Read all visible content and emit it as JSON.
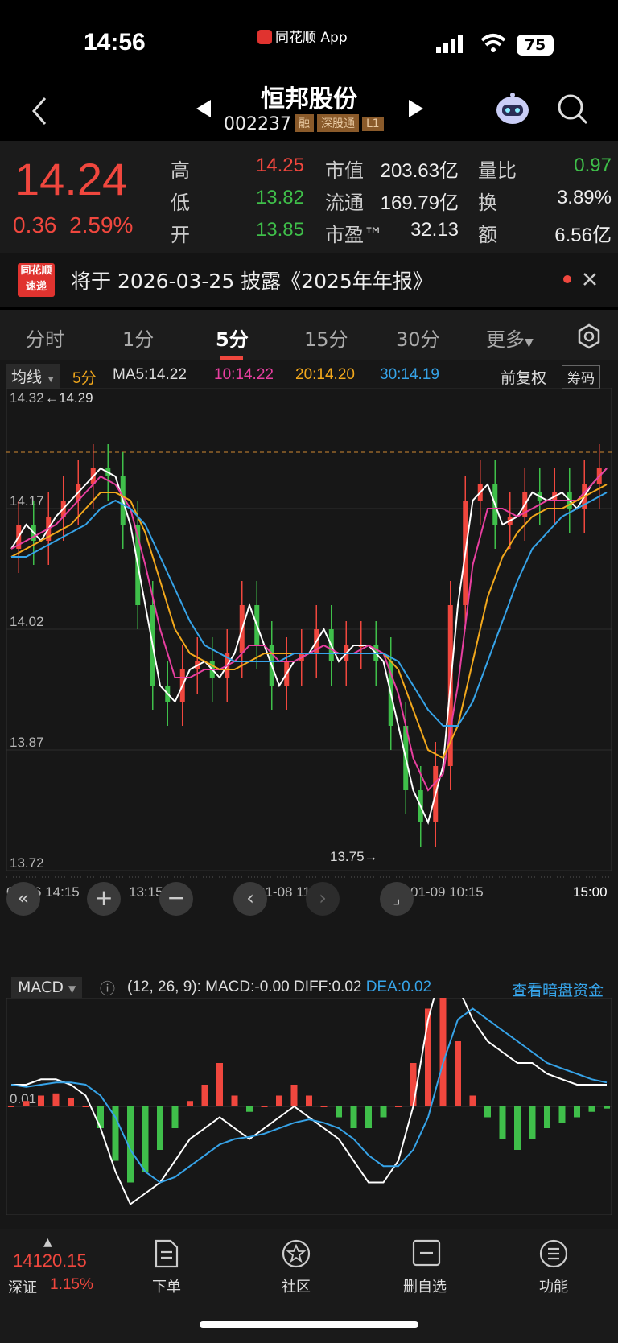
{
  "status_bar": {
    "time": "14:56",
    "app_name": "同花顺 App",
    "battery": "75"
  },
  "header": {
    "stock_name": "恒邦股份",
    "stock_code": "002237",
    "tags": [
      "融",
      "深股通",
      "L1"
    ]
  },
  "quote": {
    "price": "14.24",
    "change": "0.36",
    "change_pct": "2.59%",
    "rows": [
      {
        "l1": "高",
        "v1": "14.25",
        "l2": "市值",
        "v2": "203.63亿",
        "l3": "量比",
        "v3": "0.97"
      },
      {
        "l1": "低",
        "v1": "13.82",
        "l2": "流通",
        "v2": "169.79亿",
        "l3": "换",
        "v3": "3.89%"
      },
      {
        "l1": "开",
        "v1": "13.85",
        "l2": "市盈™",
        "v2": "32.13",
        "l3": "额",
        "v3": "6.56亿"
      }
    ],
    "colors": {
      "up": "#f0473e",
      "down": "#3fbf4a"
    }
  },
  "notice": {
    "badge_top": "同花顺",
    "badge_bottom": "速递",
    "text": "将于 2026-03-25 披露《2025年年报》"
  },
  "tabs": [
    "分时",
    "1分",
    "5分",
    "15分",
    "30分",
    "更多"
  ],
  "active_tab": "5分",
  "ma_legend": {
    "selector": "均线",
    "period": "5分",
    "ma5": "MA5:14.22",
    "ma10": "10:14.22",
    "ma20": "20:14.20",
    "ma30": "30:14.19",
    "adjust": "前复权",
    "chips": "筹码"
  },
  "chart_data": [
    {
      "type": "line",
      "title": "",
      "y_ticks": [
        "14.32",
        "14.17",
        "14.02",
        "13.87",
        "13.72"
      ],
      "ylim": [
        13.72,
        14.32
      ],
      "x_ticks": [
        "01-06 14:15",
        "13:15",
        "01-08 11:00",
        "01-09 10:15",
        "15:00"
      ],
      "annotations": {
        "high": "14.29",
        "low": "13.75"
      },
      "series": [
        {
          "name": "MA5",
          "color": "#ffffff",
          "values": [
            14.12,
            14.15,
            14.13,
            14.16,
            14.18,
            14.2,
            14.22,
            14.21,
            14.15,
            14.05,
            13.95,
            13.93,
            13.97,
            13.98,
            13.96,
            13.99,
            14.05,
            14.0,
            13.95,
            13.98,
            13.99,
            14.02,
            13.98,
            14.0,
            14.0,
            13.98,
            13.9,
            13.82,
            13.78,
            13.85,
            14.05,
            14.18,
            14.2,
            14.15,
            14.16,
            14.19,
            14.18,
            14.19,
            14.17,
            14.2,
            14.22
          ]
        },
        {
          "name": "10",
          "color": "#e83fa0",
          "values": [
            14.12,
            14.13,
            14.14,
            14.15,
            14.17,
            14.19,
            14.21,
            14.2,
            14.17,
            14.1,
            14.02,
            13.96,
            13.96,
            13.97,
            13.97,
            13.98,
            14.0,
            14.0,
            13.98,
            13.98,
            13.99,
            14.0,
            13.99,
            13.99,
            14.0,
            13.99,
            13.94,
            13.86,
            13.82,
            13.84,
            13.95,
            14.1,
            14.17,
            14.17,
            14.16,
            14.17,
            14.18,
            14.18,
            14.18,
            14.2,
            14.22
          ]
        },
        {
          "name": "20",
          "color": "#f2a81c",
          "values": [
            14.11,
            14.12,
            14.13,
            14.14,
            14.15,
            14.17,
            14.19,
            14.19,
            14.18,
            14.14,
            14.08,
            14.02,
            13.99,
            13.98,
            13.97,
            13.97,
            13.98,
            13.99,
            13.99,
            13.99,
            13.99,
            13.99,
            13.99,
            13.99,
            13.99,
            13.99,
            13.97,
            13.92,
            13.87,
            13.86,
            13.9,
            13.98,
            14.06,
            14.11,
            14.14,
            14.16,
            14.17,
            14.17,
            14.18,
            14.19,
            14.2
          ]
        },
        {
          "name": "30",
          "color": "#36a3e8",
          "values": [
            14.11,
            14.11,
            14.12,
            14.13,
            14.14,
            14.15,
            14.17,
            14.18,
            14.17,
            14.15,
            14.11,
            14.07,
            14.03,
            14.0,
            13.99,
            13.98,
            13.98,
            13.98,
            13.98,
            13.99,
            13.99,
            13.99,
            13.99,
            13.99,
            13.99,
            13.99,
            13.98,
            13.95,
            13.92,
            13.9,
            13.9,
            13.93,
            13.98,
            14.03,
            14.08,
            14.12,
            14.14,
            14.16,
            14.17,
            14.18,
            14.19
          ]
        }
      ]
    },
    {
      "type": "bar",
      "title": "",
      "label": "MACD",
      "params": "(12, 26, 9):",
      "macd_text": "MACD:-0.00",
      "diff_text": "DIFF:0.02",
      "dea_text": "DEA:0.02",
      "y_tick": "0.01",
      "ylim": [
        -0.1,
        0.1
      ],
      "macd": [
        0.0,
        0.005,
        0.01,
        0.012,
        0.008,
        0.0,
        -0.02,
        -0.05,
        -0.07,
        -0.06,
        -0.04,
        -0.02,
        0.005,
        0.02,
        0.04,
        0.01,
        -0.005,
        0.0,
        0.01,
        0.02,
        0.01,
        0.0,
        -0.01,
        -0.02,
        -0.02,
        -0.01,
        0.0,
        0.04,
        0.09,
        0.12,
        0.06,
        0.01,
        -0.01,
        -0.03,
        -0.04,
        -0.03,
        -0.02,
        -0.015,
        -0.01,
        -0.005,
        -0.002
      ],
      "series": [
        {
          "name": "DIFF",
          "color": "#ffffff",
          "values": [
            0.02,
            0.02,
            0.025,
            0.025,
            0.02,
            0.01,
            -0.02,
            -0.06,
            -0.09,
            -0.08,
            -0.07,
            -0.05,
            -0.03,
            -0.02,
            -0.01,
            -0.02,
            -0.03,
            -0.02,
            -0.01,
            0.0,
            -0.01,
            -0.02,
            -0.03,
            -0.05,
            -0.07,
            -0.07,
            -0.05,
            0.0,
            0.08,
            0.13,
            0.11,
            0.08,
            0.06,
            0.05,
            0.04,
            0.04,
            0.03,
            0.025,
            0.02,
            0.02,
            0.02
          ]
        },
        {
          "name": "DEA",
          "color": "#36a3e8",
          "values": [
            0.02,
            0.018,
            0.02,
            0.022,
            0.022,
            0.02,
            0.01,
            -0.01,
            -0.04,
            -0.06,
            -0.07,
            -0.065,
            -0.055,
            -0.045,
            -0.035,
            -0.03,
            -0.028,
            -0.025,
            -0.02,
            -0.015,
            -0.012,
            -0.015,
            -0.02,
            -0.03,
            -0.045,
            -0.055,
            -0.055,
            -0.04,
            -0.01,
            0.04,
            0.08,
            0.09,
            0.08,
            0.07,
            0.06,
            0.05,
            0.04,
            0.035,
            0.03,
            0.025,
            0.022
          ]
        }
      ]
    }
  ],
  "macd_link": "查看暗盘资金",
  "bottom_bar": {
    "index_value": "14120.15",
    "index_name": "深证",
    "index_change": "1.15%",
    "items": [
      {
        "label": "下单",
        "icon": "order-icon"
      },
      {
        "label": "社区",
        "icon": "community-icon"
      },
      {
        "label": "删自选",
        "icon": "remove-watchlist-icon"
      },
      {
        "label": "功能",
        "icon": "menu-icon"
      }
    ]
  }
}
